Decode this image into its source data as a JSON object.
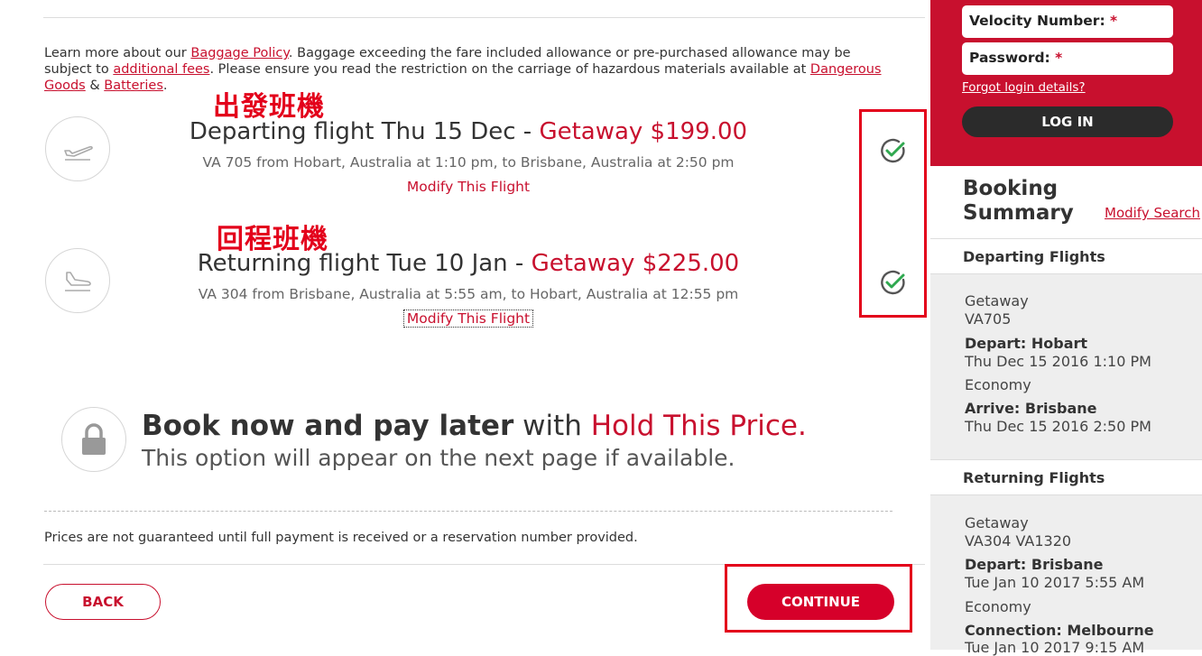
{
  "baggage": {
    "text1": "Learn more about our ",
    "link_baggage": "Baggage Policy",
    "text2": ". Baggage exceeding the fare included allowance or pre-purchased allowance may be subject to ",
    "link_fees": "additional fees",
    "text3": ". Please ensure you read the restriction on the carriage of hazardous materials available at ",
    "link_dangerous": "Dangerous Goods",
    "text4": " & ",
    "link_batteries": "Batteries",
    "text5": "."
  },
  "departing": {
    "annotation": "出發班機",
    "title_prefix": "Departing flight Thu 15 Dec - ",
    "price": "Getaway $199.00",
    "detail": "VA 705 from Hobart, Australia at 1:10 pm, to Brisbane, Australia at 2:50 pm",
    "modify": "Modify This Flight"
  },
  "returning": {
    "annotation": "回程班機",
    "title_prefix": "Returning flight Tue 10 Jan - ",
    "price": "Getaway $225.00",
    "detail": "VA 304 from Brisbane, Australia at 5:55 am, to Hobart, Australia at 12:55 pm",
    "modify": "Modify This Flight"
  },
  "hold": {
    "bold": "Book now and pay later",
    "middle": " with ",
    "red": "Hold This Price.",
    "line2": "This option will appear on the next page if available."
  },
  "prices_note": "Prices are not guaranteed until full payment is received or a reservation number provided.",
  "buttons": {
    "back": "BACK",
    "continue": "CONTINUE"
  },
  "login": {
    "velocity_label": "Velocity Number: ",
    "password_label": "Password: ",
    "required_mark": "*",
    "forgot": "Forgot login details?",
    "login_button": "LOG IN"
  },
  "summary": {
    "title": "Booking Summary",
    "modify_search": "Modify Search",
    "departing_header": "Departing Flights",
    "dep_fare": "Getaway",
    "dep_flight": "VA705",
    "dep_depart": "Depart: Hobart",
    "dep_depart_time": "Thu Dec 15 2016 1:10 PM",
    "dep_class": "Economy",
    "dep_arrive": "Arrive: Brisbane",
    "dep_arrive_time": "Thu Dec 15 2016 2:50 PM",
    "returning_header": "Returning Flights",
    "ret_fare": "Getaway",
    "ret_flight": "VA304 VA1320",
    "ret_depart": "Depart: Brisbane",
    "ret_depart_time": "Tue Jan 10 2017 5:55 AM",
    "ret_class": "Economy",
    "ret_connection": "Connection: Melbourne",
    "ret_connection_time": "Tue Jan 10 2017 9:15 AM"
  },
  "colors": {
    "brand_red": "#c8102e",
    "annotation_red": "#e3001b",
    "check_green": "#2fa84f",
    "dark_button": "#2b2b2b",
    "sidebar_bg": "#eeeeee"
  },
  "icons": [
    "plane-takeoff-icon",
    "plane-landing-icon",
    "check-circle-icon",
    "lock-icon"
  ]
}
